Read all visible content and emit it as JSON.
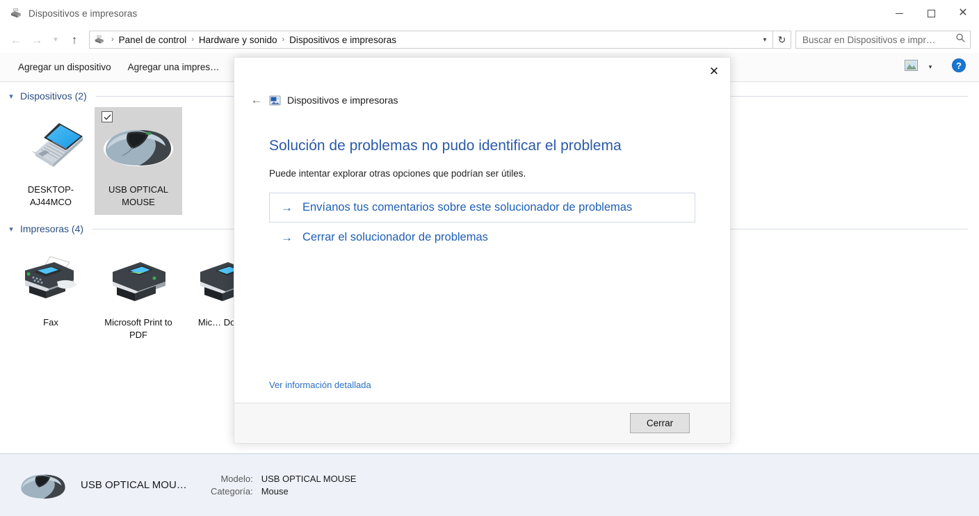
{
  "window": {
    "title": "Dispositivos e impresoras",
    "icon": "devices-printers-icon",
    "controls": {
      "minimize": "minimize-icon",
      "maximize": "maximize-icon",
      "close": "close-icon"
    }
  },
  "addressbar": {
    "back": "back-arrow-icon",
    "forward": "forward-arrow-icon",
    "recent": "recent-locations-chevron-icon",
    "up": "up-arrow-icon",
    "breadcrumb": [
      "Panel de control",
      "Hardware y sonido",
      "Dispositivos e impresoras"
    ],
    "separator": "›",
    "dropdown_caret": "⌄",
    "refresh": "↻",
    "search": {
      "placeholder": "Buscar en Dispositivos e impr…",
      "icon": "search-icon"
    }
  },
  "toolbar": {
    "items": [
      "Agregar un dispositivo",
      "Agregar una impres…"
    ],
    "view_icon": "view-mode-icon",
    "view_caret": "▾",
    "help_icon": "help-icon",
    "help_glyph": "?"
  },
  "content": {
    "groups": [
      {
        "title": "Dispositivos (2)",
        "chevron": "⌄",
        "items": [
          {
            "label": "DESKTOP-AJ44MCO",
            "icon": "laptop-icon",
            "selected": false,
            "checked": false
          },
          {
            "label": "USB OPTICAL MOUSE",
            "icon": "mouse-icon",
            "selected": true,
            "checked": true
          }
        ]
      },
      {
        "title": "Impresoras (4)",
        "chevron": "⌄",
        "items": [
          {
            "label": "Fax",
            "icon": "fax-icon",
            "selected": false,
            "checked": false
          },
          {
            "label": "Microsoft Print to PDF",
            "icon": "printer-icon",
            "selected": false,
            "checked": false
          },
          {
            "label": "Mic… Docu…",
            "icon": "printer-icon",
            "selected": false,
            "checked": false
          }
        ]
      }
    ]
  },
  "details": {
    "name": "USB OPTICAL MOU…",
    "icon": "mouse-icon",
    "fields": [
      {
        "label": "Modelo:",
        "value": "USB OPTICAL MOUSE"
      },
      {
        "label": "Categoría:",
        "value": "Mouse"
      }
    ]
  },
  "dialog": {
    "close_glyph": "✕",
    "back_glyph": "←",
    "header_icon": "devices-printers-small-icon",
    "header_title": "Dispositivos e impresoras",
    "heading": "Solución de problemas no pudo identificar el problema",
    "subtitle": "Puede intentar explorar otras opciones que podrían ser útiles.",
    "arrow_glyph": "→",
    "actions": [
      {
        "label": "Envíanos tus comentarios sobre este solucionador de problemas",
        "boxed": true
      },
      {
        "label": "Cerrar el solucionador de problemas",
        "boxed": false
      }
    ],
    "detail_link": "Ver información detallada",
    "close_button": "Cerrar"
  },
  "colors": {
    "accent_blue": "#2b5aa8",
    "link_blue": "#1f5fb5",
    "group_title": "#2b4f81",
    "details_bg": "#eef1f8",
    "selected_tile": "#d4d4d4"
  }
}
